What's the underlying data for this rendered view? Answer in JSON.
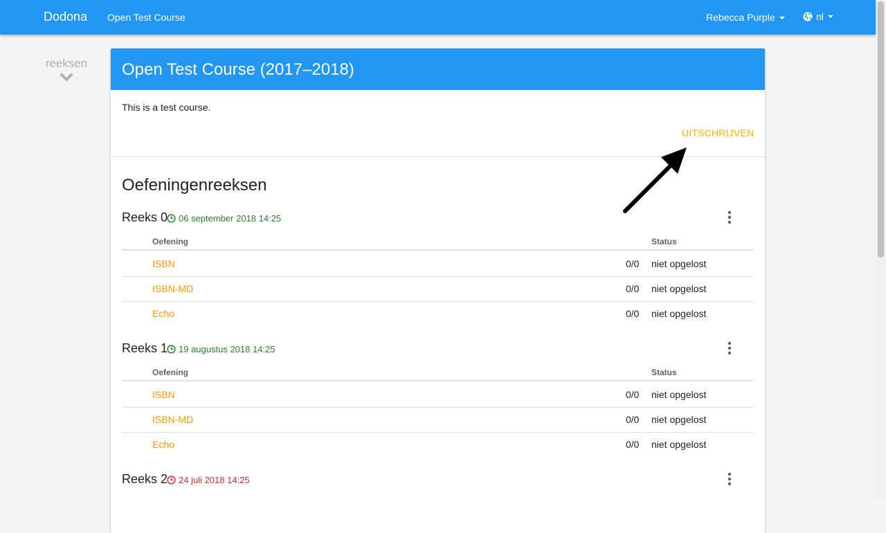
{
  "navbar": {
    "brand": "Dodona",
    "course_link": "Open Test Course",
    "user": "Rebecca Purple",
    "language": "nl",
    "bg_color": "#2196f3"
  },
  "side_nav": {
    "label": "reeksen",
    "icon": "chevron-down-icon"
  },
  "course": {
    "title": "Open Test Course (2017–2018)",
    "description": "This is a test course.",
    "unsubscribe_label": "UITSCHRIJVEN",
    "unsubscribe_color": "#ffb300"
  },
  "section_title": "Oefeningenreeksen",
  "series": [
    {
      "name": "Reeks 0",
      "deadline": "06 september 2018 14:25",
      "deadline_status": "future",
      "columns": {
        "exercise": "Oefening",
        "status": "Status"
      },
      "exercises": [
        {
          "name": "ISBN",
          "score": "0/0",
          "status": "niet opgelost"
        },
        {
          "name": "ISBN-MD",
          "score": "0/0",
          "status": "niet opgelost"
        },
        {
          "name": "Echo",
          "score": "0/0",
          "status": "niet opgelost"
        }
      ]
    },
    {
      "name": "Reeks 1",
      "deadline": "19 augustus 2018 14:25",
      "deadline_status": "future",
      "columns": {
        "exercise": "Oefening",
        "status": "Status"
      },
      "exercises": [
        {
          "name": "ISBN",
          "score": "0/0",
          "status": "niet opgelost"
        },
        {
          "name": "ISBN-MD",
          "score": "0/0",
          "status": "niet opgelost"
        },
        {
          "name": "Echo",
          "score": "0/0",
          "status": "niet opgelost"
        }
      ]
    },
    {
      "name": "Reeks 2",
      "deadline": "24 juli 2018 14:25",
      "deadline_status": "past"
    }
  ],
  "colors": {
    "deadline_future": "#2e7d32",
    "deadline_past": "#d32f2f",
    "exercise_link": "#ff9800"
  }
}
